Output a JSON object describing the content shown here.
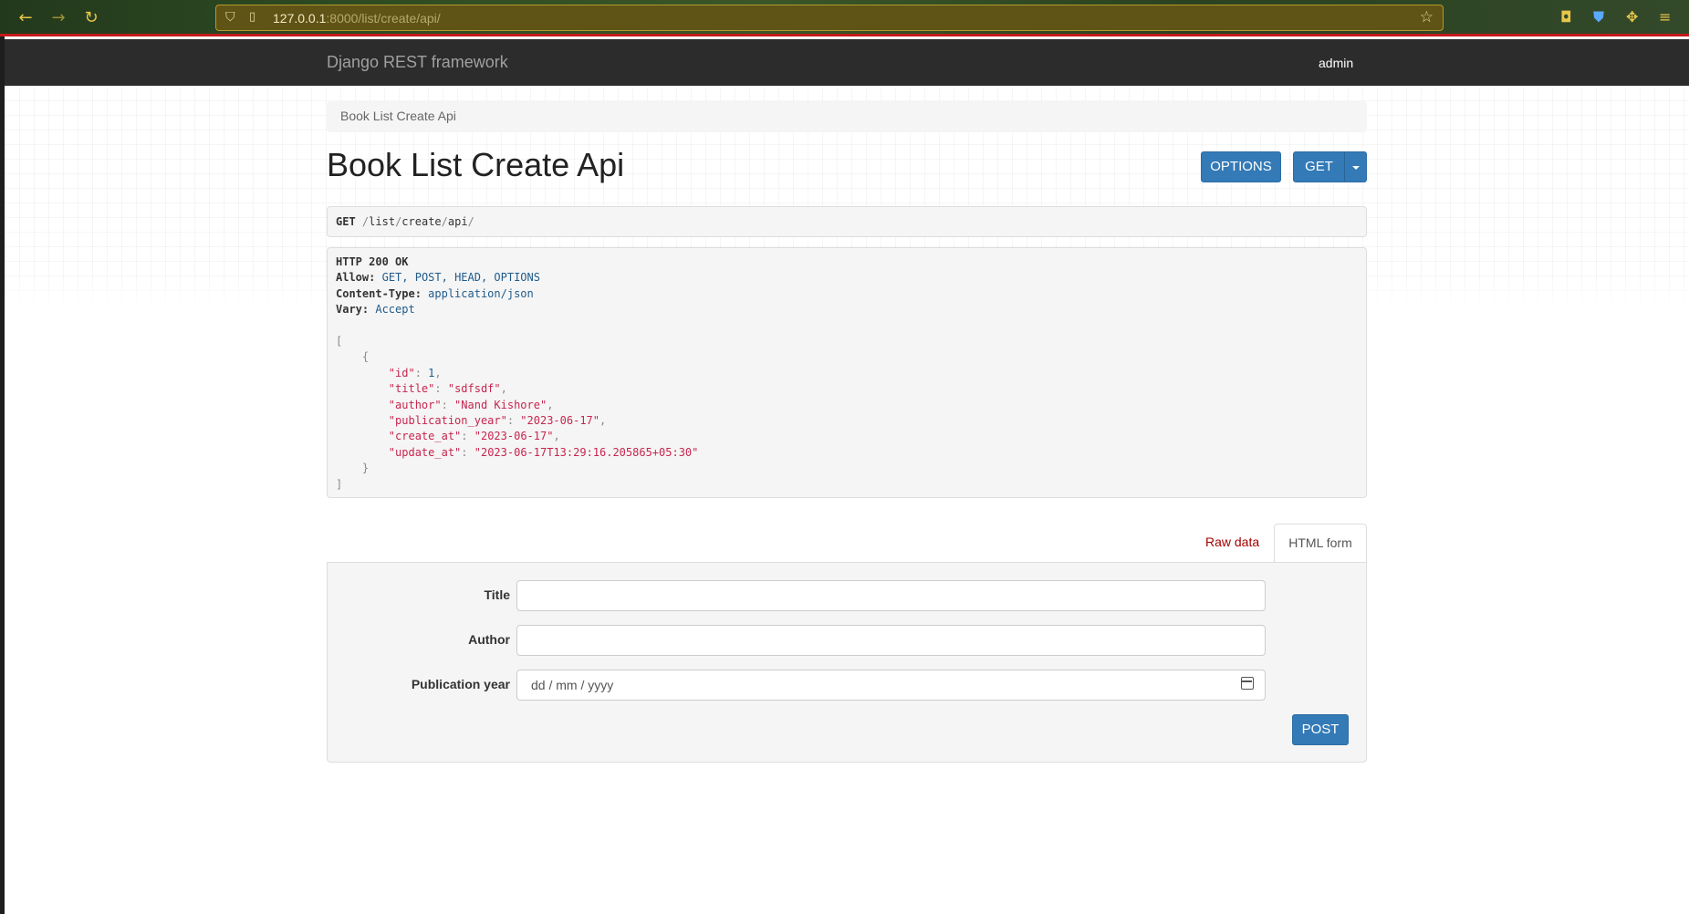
{
  "browser": {
    "url_host": "127.0.0.1",
    "url_rest": ":8000/list/create/api/"
  },
  "navbar": {
    "brand": "Django REST framework",
    "user": "admin"
  },
  "breadcrumb": "Book List Create Api",
  "page_title": "Book List Create Api",
  "buttons": {
    "options": "OPTIONS",
    "get": "GET",
    "post": "POST"
  },
  "request": {
    "method": "GET",
    "path_parts": [
      "list",
      "create",
      "api"
    ]
  },
  "response": {
    "status": "HTTP 200 OK",
    "headers": [
      {
        "key": "Allow:",
        "value": "GET, POST, HEAD, OPTIONS"
      },
      {
        "key": "Content-Type:",
        "value": "application/json"
      },
      {
        "key": "Vary:",
        "value": "Accept"
      }
    ],
    "body": [
      {
        "id": 1,
        "title": "sdfsdf",
        "author": "Nand Kishore",
        "publication_year": "2023-06-17",
        "create_at": "2023-06-17",
        "update_at": "2023-06-17T13:29:16.205865+05:30"
      }
    ]
  },
  "tabs": {
    "raw": "Raw data",
    "html": "HTML form"
  },
  "form": {
    "title_label": "Title",
    "author_label": "Author",
    "pubyear_label": "Publication year",
    "pubyear_placeholder": "dd / mm / yyyy"
  },
  "colors": {
    "navbar_bg": "#2c2c2c",
    "primary": "#337ab7",
    "link_red": "#a30000",
    "json_string": "#c7254e"
  }
}
